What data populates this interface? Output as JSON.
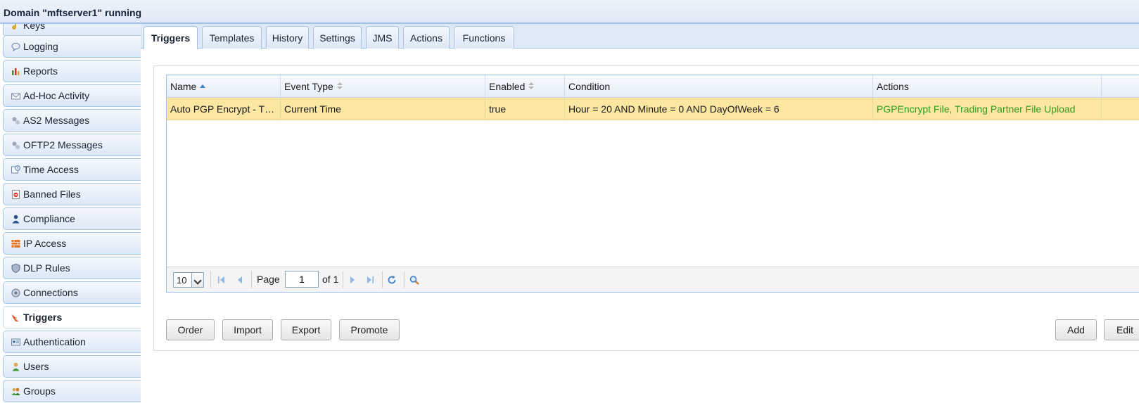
{
  "window": {
    "title": "Domain \"mftserver1\" running"
  },
  "sidebar": {
    "items": [
      {
        "label": "Keys",
        "icon": "key-icon"
      },
      {
        "label": "Logging",
        "icon": "speech-bubble-icon"
      },
      {
        "label": "Reports",
        "icon": "bar-chart-icon"
      },
      {
        "label": "Ad-Hoc Activity",
        "icon": "envelope-icon"
      },
      {
        "label": "AS2 Messages",
        "icon": "gears-icon"
      },
      {
        "label": "OFTP2 Messages",
        "icon": "gears-icon"
      },
      {
        "label": "Time Access",
        "icon": "calendar-clock-icon"
      },
      {
        "label": "Banned Files",
        "icon": "banned-file-icon"
      },
      {
        "label": "Compliance",
        "icon": "person-icon"
      },
      {
        "label": "IP Access",
        "icon": "firewall-icon"
      },
      {
        "label": "DLP Rules",
        "icon": "shield-icon"
      },
      {
        "label": "Connections",
        "icon": "network-icon"
      },
      {
        "label": "Triggers",
        "icon": "trigger-icon",
        "active": true
      },
      {
        "label": "Authentication",
        "icon": "id-card-icon"
      },
      {
        "label": "Users",
        "icon": "user-icon"
      },
      {
        "label": "Groups",
        "icon": "users-icon"
      }
    ]
  },
  "tabs": [
    {
      "label": "Triggers",
      "active": true
    },
    {
      "label": "Templates"
    },
    {
      "label": "History"
    },
    {
      "label": "Settings"
    },
    {
      "label": "JMS"
    },
    {
      "label": "Actions"
    },
    {
      "label": "Functions"
    }
  ],
  "grid": {
    "columns": [
      "Name",
      "Event Type",
      "Enabled",
      "Condition",
      "Actions"
    ],
    "rows": [
      {
        "name": "Auto PGP Encrypt - T…",
        "event_type": "Current Time",
        "enabled": "true",
        "condition": "Hour = 20 AND Minute = 0 AND DayOfWeek = 6",
        "actions": "PGPEncrypt File, Trading Partner File Upload"
      }
    ]
  },
  "pager": {
    "page_size": "10",
    "page_label": "Page",
    "page_value": "1",
    "of_label": "of 1"
  },
  "buttons": {
    "order": "Order",
    "import": "Import",
    "export": "Export",
    "promote": "Promote",
    "add": "Add",
    "edit": "Edit"
  },
  "colors": {
    "selected_row": "#fbe7a1",
    "action_link": "#2c9e1b",
    "accent_border": "#9ec0e8"
  }
}
